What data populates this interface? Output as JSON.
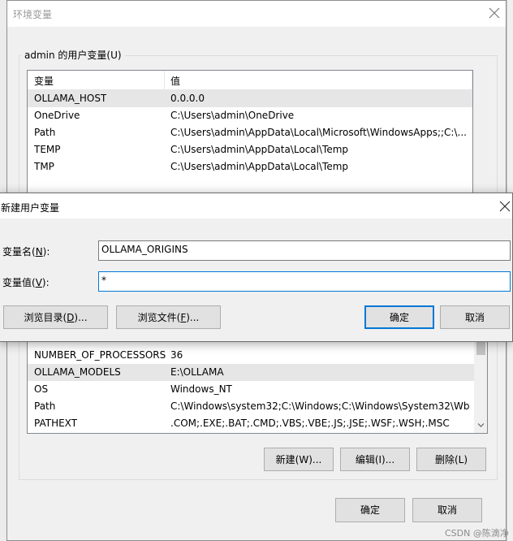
{
  "outer_dialog": {
    "title": "环境变量",
    "user_group_label": "admin 的用户变量(U)",
    "user_vars": {
      "headers": [
        "变量",
        "值"
      ],
      "rows": [
        {
          "name": "OLLAMA_HOST",
          "value": "0.0.0.0"
        },
        {
          "name": "OneDrive",
          "value": "C:\\Users\\admin\\OneDrive"
        },
        {
          "name": "Path",
          "value": "C:\\Users\\admin\\AppData\\Local\\Microsoft\\WindowsApps;;C:\\..."
        },
        {
          "name": "TEMP",
          "value": "C:\\Users\\admin\\AppData\\Local\\Temp"
        },
        {
          "name": "TMP",
          "value": "C:\\Users\\admin\\AppData\\Local\\Temp"
        }
      ]
    },
    "system_vars": {
      "rows": [
        {
          "name": "NUMBER_OF_PROCESSORS",
          "value": "36"
        },
        {
          "name": "OLLAMA_MODELS",
          "value": "E:\\OLLAMA"
        },
        {
          "name": "OS",
          "value": "Windows_NT"
        },
        {
          "name": "Path",
          "value": "C:\\Windows\\system32;C:\\Windows;C:\\Windows\\System32\\Wb..."
        },
        {
          "name": "PATHEXT",
          "value": ".COM;.EXE;.BAT;.CMD;.VBS;.VBE;.JS;.JSE;.WSF;.WSH;.MSC"
        }
      ]
    },
    "system_buttons": {
      "new": "新建(W)...",
      "edit": "编辑(I)...",
      "delete": "删除(L)"
    },
    "ok": "确定",
    "cancel": "取消"
  },
  "new_var_dialog": {
    "title": "新建用户变量",
    "name_label_pre": "变量名(",
    "name_label_key": "N",
    "name_label_post": "):",
    "value_label_pre": "变量值(",
    "value_label_key": "V",
    "value_label_post": "):",
    "name_value": "OLLAMA_ORIGINS",
    "value_value": "*",
    "browse_dir_pre": "浏览目录(",
    "browse_dir_key": "D",
    "browse_dir_post": ")...",
    "browse_file_pre": "浏览文件(",
    "browse_file_key": "F",
    "browse_file_post": ")...",
    "ok": "确定",
    "cancel": "取消"
  },
  "watermark": "CSDN @陈滴净"
}
